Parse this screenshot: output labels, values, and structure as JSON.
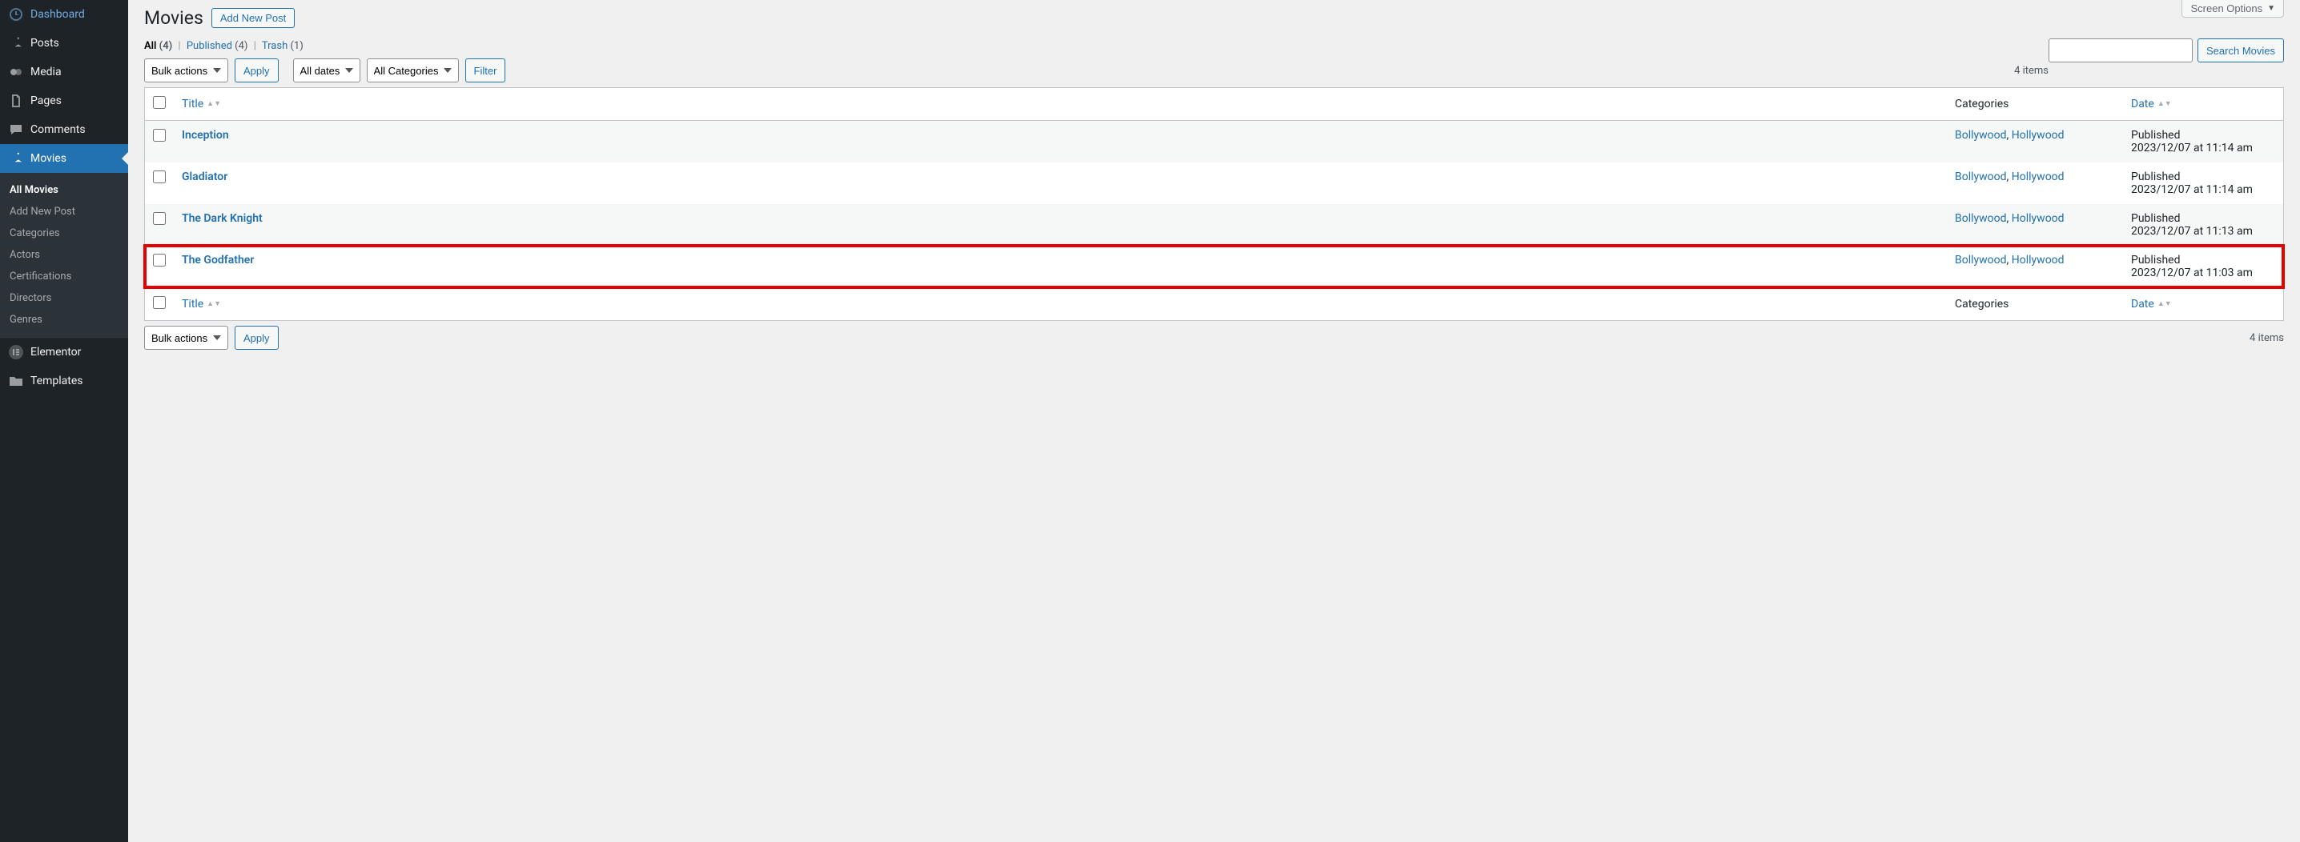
{
  "screen_options": "Screen Options",
  "page_title": "Movies",
  "add_new": "Add New Post",
  "sidebar": {
    "items": [
      {
        "label": "Dashboard"
      },
      {
        "label": "Posts"
      },
      {
        "label": "Media"
      },
      {
        "label": "Pages"
      },
      {
        "label": "Comments"
      },
      {
        "label": "Movies"
      },
      {
        "label": "Elementor"
      },
      {
        "label": "Templates"
      }
    ],
    "submenu": [
      {
        "label": "All Movies"
      },
      {
        "label": "Add New Post"
      },
      {
        "label": "Categories"
      },
      {
        "label": "Actors"
      },
      {
        "label": "Certifications"
      },
      {
        "label": "Directors"
      },
      {
        "label": "Genres"
      }
    ]
  },
  "views": {
    "all_label": "All",
    "all_count": "(4)",
    "published_label": "Published",
    "published_count": "(4)",
    "trash_label": "Trash",
    "trash_count": "(1)"
  },
  "filters": {
    "bulk": "Bulk actions",
    "apply": "Apply",
    "dates": "All dates",
    "categories": "All Categories",
    "filter_btn": "Filter"
  },
  "search": {
    "button": "Search Movies"
  },
  "items_count": "4 items",
  "columns": {
    "title": "Title",
    "categories": "Categories",
    "date": "Date"
  },
  "rows": [
    {
      "title": "Inception",
      "cat1": "Bollywood",
      "cat2": "Hollywood",
      "status": "Published",
      "date": "2023/12/07 at 11:14 am"
    },
    {
      "title": "Gladiator",
      "cat1": "Bollywood",
      "cat2": "Hollywood",
      "status": "Published",
      "date": "2023/12/07 at 11:14 am"
    },
    {
      "title": "The Dark Knight",
      "cat1": "Bollywood",
      "cat2": "Hollywood",
      "status": "Published",
      "date": "2023/12/07 at 11:13 am"
    },
    {
      "title": "The Godfather",
      "cat1": "Bollywood",
      "cat2": "Hollywood",
      "status": "Published",
      "date": "2023/12/07 at 11:03 am"
    }
  ],
  "sep": ", "
}
